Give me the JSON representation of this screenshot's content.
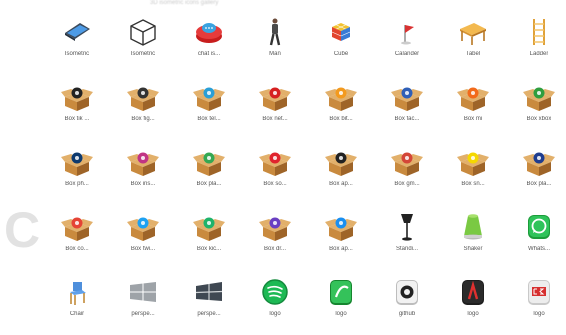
{
  "header_text": "3D isometric icons gallery",
  "watermark_text": "C",
  "colors": {
    "box": "#c98a3e",
    "box_dark": "#9e6428",
    "box_light": "#e2b06b"
  },
  "rows": [
    [
      {
        "label": "Isometric",
        "icon": "phone-icon"
      },
      {
        "label": "Isometric",
        "icon": "wireframe-cube-icon"
      },
      {
        "label": "chat is...",
        "icon": "chat-button-icon"
      },
      {
        "label": "Man",
        "icon": "man-icon"
      },
      {
        "label": "Cube",
        "icon": "rubik-cube-icon"
      },
      {
        "label": "Calander",
        "icon": "calendar-flag-icon"
      },
      {
        "label": "Tabel",
        "icon": "table-icon"
      },
      {
        "label": "Ladder",
        "icon": "ladder-icon"
      }
    ],
    [
      {
        "label": "Box tik ...",
        "icon": "box-tiktok-icon",
        "badge": "#222222"
      },
      {
        "label": "Box fig...",
        "icon": "box-figma-icon",
        "badge": "#333333"
      },
      {
        "label": "Box tel...",
        "icon": "box-telegram-icon",
        "badge": "#2a9fd6"
      },
      {
        "label": "Box net...",
        "icon": "box-netflix-icon",
        "badge": "#d62020"
      },
      {
        "label": "Box bit...",
        "icon": "box-bitcoin-icon",
        "badge": "#f39a1e"
      },
      {
        "label": "Box fac...",
        "icon": "box-facebook-icon",
        "badge": "#2f5fb7"
      },
      {
        "label": "Box mi",
        "icon": "box-mi-icon",
        "badge": "#f26a1b"
      },
      {
        "label": "Box xbox",
        "icon": "box-xbox-icon",
        "badge": "#2f9e3f"
      }
    ],
    [
      {
        "label": "Box ph...",
        "icon": "box-photoshop-icon",
        "badge": "#0e3a6e"
      },
      {
        "label": "Box ins...",
        "icon": "box-instagram-icon",
        "badge": "#c13584"
      },
      {
        "label": "Box pla...",
        "icon": "box-play-icon",
        "badge": "#34a853"
      },
      {
        "label": "Box so...",
        "icon": "box-social-icon",
        "badge": "#e0232e"
      },
      {
        "label": "Box ap...",
        "icon": "box-apple-icon",
        "badge": "#222222"
      },
      {
        "label": "Box gm...",
        "icon": "box-gmail-icon",
        "badge": "#d44638"
      },
      {
        "label": "Box sn...",
        "icon": "box-snapchat-icon",
        "badge": "#f5d800"
      },
      {
        "label": "Box pla...",
        "icon": "box-playstation-icon",
        "badge": "#1f3d8f"
      }
    ],
    [
      {
        "label": "Box co...",
        "icon": "box-chrome-icon",
        "badge": "#e54335"
      },
      {
        "label": "Box twi...",
        "icon": "box-twitter-icon",
        "badge": "#1da1f2"
      },
      {
        "label": "Box kic...",
        "icon": "box-kickstarter-icon",
        "badge": "#1fb36b"
      },
      {
        "label": "Box dr...",
        "icon": "box-discord-icon",
        "badge": "#6a3fc2"
      },
      {
        "label": "Box ap...",
        "icon": "box-appstore-icon",
        "badge": "#1a8ff0"
      },
      {
        "label": "Standi...",
        "icon": "standing-lamp-icon"
      },
      {
        "label": "Shaker",
        "icon": "shaker-icon"
      },
      {
        "label": "Whats...",
        "icon": "whatsapp-icon"
      }
    ],
    [
      {
        "label": "Chair",
        "icon": "chair-icon"
      },
      {
        "label": "perspe...",
        "icon": "perspective-panel-icon"
      },
      {
        "label": "perspe...",
        "icon": "perspective-window-icon"
      },
      {
        "label": "logo",
        "icon": "spotify-logo-icon"
      },
      {
        "label": "logo",
        "icon": "android-logo-icon"
      },
      {
        "label": "github",
        "icon": "github-logo-icon"
      },
      {
        "label": "logo",
        "icon": "adobe-logo-icon"
      },
      {
        "label": "logo",
        "icon": "cs-logo-icon"
      }
    ]
  ]
}
